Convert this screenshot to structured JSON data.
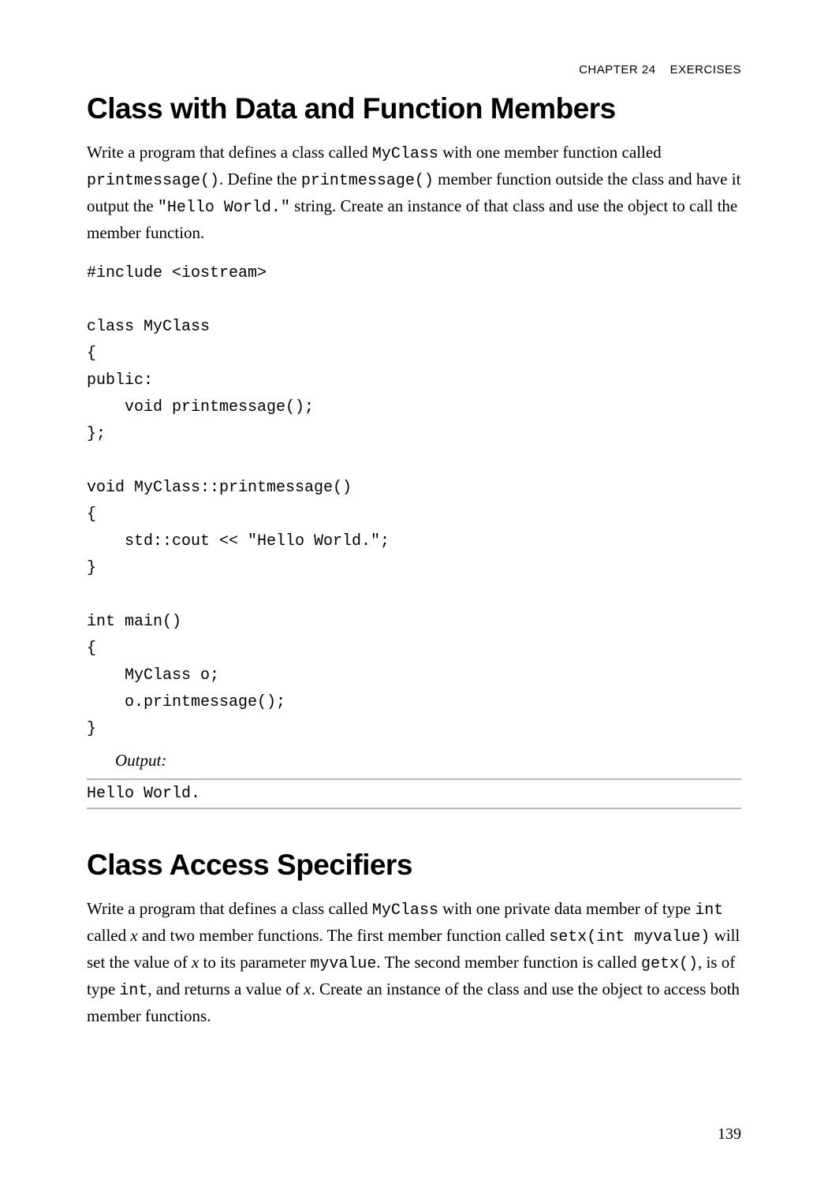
{
  "header": {
    "chapter": "CHAPTER 24",
    "section": "EXERCISES"
  },
  "section1": {
    "title": "Class with Data and Function Members",
    "p1_part1": "Write a program that defines a class called ",
    "p1_code1": "MyClass",
    "p1_part2": " with one member function called ",
    "p1_code2": "printmessage()",
    "p1_part3": ". Define the ",
    "p1_code3": "printmessage()",
    "p1_part4": " member function outside the class and have it output the ",
    "p1_code4": "\"Hello World.\"",
    "p1_part5": " string. Create an instance of that class and use the object to call the member function.",
    "code": "#include <iostream>\n\nclass MyClass\n{\npublic:\n    void printmessage();\n};\n\nvoid MyClass::printmessage()\n{\n    std::cout << \"Hello World.\";\n}\n\nint main()\n{\n    MyClass o;\n    o.printmessage();\n}",
    "output_label": "Output:",
    "output": "Hello World."
  },
  "section2": {
    "title": "Class Access Specifiers",
    "p1_part1": "Write a program that defines a class called ",
    "p1_code1": "MyClass",
    "p1_part2": " with one private data member of type ",
    "p1_code2": "int",
    "p1_part3": " called ",
    "p1_italic1": "x",
    "p1_part4": " and two member functions. The first member function called ",
    "p1_code3": "setx(int myvalue)",
    "p1_part5": " will set the value of ",
    "p1_italic2": "x",
    "p1_part6": " to its parameter ",
    "p1_code4": "myvalue",
    "p1_part7": ". The second member function is called ",
    "p1_code5": "getx()",
    "p1_part8": ", is of type ",
    "p1_code6": "int",
    "p1_part9": ", and returns a value of ",
    "p1_italic3": "x",
    "p1_part10": ". Create an instance of the class and use the object to access both member functions."
  },
  "page_number": "139"
}
